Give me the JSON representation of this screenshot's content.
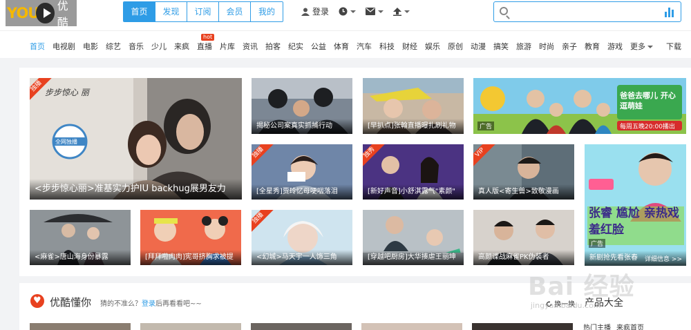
{
  "logo": {
    "text_latin": "YOU",
    "text_cn": "优酷"
  },
  "nav_tabs": [
    "首页",
    "发现",
    "订阅",
    "会员",
    "我的"
  ],
  "user_bar": {
    "login": "登录"
  },
  "search": {
    "placeholder": ""
  },
  "categories": [
    "首页",
    "电视剧",
    "电影",
    "综艺",
    "音乐",
    "少儿",
    "来疯",
    "直播",
    "片库",
    "资讯",
    "拍客",
    "纪实",
    "公益",
    "体育",
    "汽车",
    "科技",
    "财经",
    "娱乐",
    "原创",
    "动漫",
    "搞笑",
    "旅游",
    "时尚",
    "亲子",
    "教育",
    "游戏",
    "更多"
  ],
  "hot_badge": "hot",
  "download": "下载",
  "cards": [
    {
      "caption": "<步步惊心丽>准基实力护IU backhug展男友力",
      "badge": "独播",
      "art_title": "步步惊心 丽",
      "art_seal": "全网独播"
    },
    {
      "caption": "揭秘公司案真实抓捕行动"
    },
    {
      "caption": "[早扒点]张翰直播曝扎刷礼物"
    },
    {
      "caption": "",
      "ad": "广告",
      "art_title": "爸爸去哪儿 开心逗萌娃",
      "art_sub": "每周五晚20:00播出"
    },
    {
      "caption": "[全星秀]贾玲忆母哽咽落泪",
      "badge": "独播"
    },
    {
      "caption": "[新好声音]小舒淇露气\"素颜\"",
      "badge": "独秀"
    },
    {
      "caption": "真人版<寄生兽>致敬漫画",
      "badge": "VIP"
    },
    {
      "caption": "新剧抢先看张春",
      "ad": "广告",
      "detail": "详细信息 >>",
      "art_title": "张睿 尴尬 亲热戏 羞红脸"
    },
    {
      "caption": "<麻雀>唐山海身份暴露"
    },
    {
      "caption": "[拜拜啦肉肉]宪哥挤胸求被提"
    },
    {
      "caption": "<幻城>马天宇一人饰三角",
      "badge": "独播"
    },
    {
      "caption": "[穿越吧厨房]大华揍虐王丽坤"
    },
    {
      "caption": "高颜谍战麻雀PK伪装者"
    }
  ],
  "section": {
    "title": "优酷懂你",
    "sub_prefix": "猜的不准么？",
    "sub_link": "登录",
    "sub_suffix": "后再看看吧~~",
    "refresh": "换一换",
    "product_all": "产品大全",
    "hotlist": [
      "热门主播",
      "来疯首页"
    ]
  },
  "watermark": {
    "main": "Bai 经验",
    "url": "jingyan.baidu.com"
  }
}
